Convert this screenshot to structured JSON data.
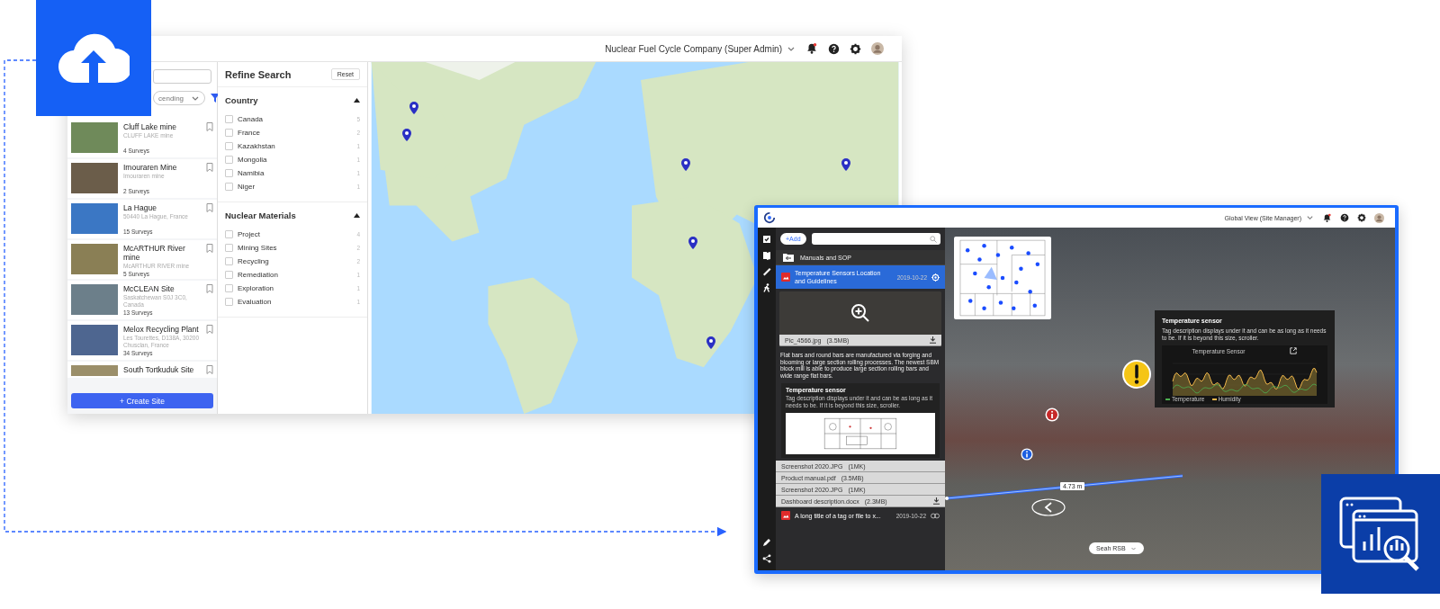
{
  "sites_app": {
    "header": {
      "account": "Nuclear Fuel Cycle Company (Super Admin)"
    },
    "site_list": {
      "sort": "cending",
      "sites": [
        {
          "name": "Cluff Lake mine",
          "address": "CLUFF LAKE mine",
          "surveys": "4 Surveys"
        },
        {
          "name": "Imouraren Mine",
          "address": "Imouraren mine",
          "surveys": "2 Surveys"
        },
        {
          "name": "La Hague",
          "address": "50440 La Hague, France",
          "surveys": "15 Surveys"
        },
        {
          "name": "McARTHUR River mine",
          "address": "McARTHUR RIVER mine",
          "surveys": "5 Surveys"
        },
        {
          "name": "McCLEAN Site",
          "address": "Saskatchewan S0J 3C0, Canada",
          "surveys": "13 Surveys"
        },
        {
          "name": "Melox Recycling Plant",
          "address": "Les Tourettes, D138A, 30200 Chusclan, France",
          "surveys": "34 Surveys"
        },
        {
          "name": "South Tortkuduk Site"
        }
      ],
      "create_button": "+ Create Site"
    },
    "refine": {
      "title": "Refine Search",
      "reset": "Reset",
      "sections": [
        {
          "title": "Country",
          "expanded": true,
          "options": [
            {
              "label": "Canada",
              "count": "5",
              "checked": false
            },
            {
              "label": "France",
              "count": "2",
              "checked": false
            },
            {
              "label": "Kazakhstan",
              "count": "1",
              "checked": false
            },
            {
              "label": "Mongolia",
              "count": "1",
              "checked": false
            },
            {
              "label": "Namibia",
              "count": "1",
              "checked": false
            },
            {
              "label": "Niger",
              "count": "1",
              "checked": false
            }
          ]
        },
        {
          "title": "Nuclear Materials",
          "expanded": true,
          "options": [
            {
              "label": "Project",
              "count": "4",
              "checked": false
            },
            {
              "label": "Mining Sites",
              "count": "2",
              "checked": false
            },
            {
              "label": "Recycling",
              "count": "2",
              "checked": false
            },
            {
              "label": "Remediation",
              "count": "1",
              "checked": false
            },
            {
              "label": "Exploration",
              "count": "1",
              "checked": false
            },
            {
              "label": "Evaluation",
              "count": "1",
              "checked": false
            }
          ]
        }
      ]
    }
  },
  "viewer_app": {
    "header": {
      "view": "Global View (Site Manager)"
    },
    "panel": {
      "add_button": "+Add",
      "folder": "Manuals and SOP",
      "items": [
        {
          "title": "Temperature Sensors Location and Guidelines",
          "date": "2019-10-22",
          "selected": true
        },
        {
          "title": "A long title of a tag or file to x...",
          "date": "2019-10-22",
          "selected": false
        }
      ],
      "preview_file": {
        "name": "Pic_4566.jpg",
        "size": "(3.5MB)"
      },
      "description": "Flat bars and round bars are manufactured via forging and blooming or large section rolling processes. The newest SBM block mill is able to produce large section rolling bars and wide range flat bars.",
      "sensor_card": {
        "title": "Temperature sensor",
        "text": "Tag description displays under it and can be as long as it needs to be. If it is beyond this size, scroller."
      },
      "files": [
        {
          "name": "Screenshot 2020.JPG",
          "size": "(1MK)"
        },
        {
          "name": "Product manual.pdf",
          "size": "(3.5MB)"
        },
        {
          "name": "Screenshot 2020.JPG",
          "size": "(1MK)"
        },
        {
          "name": "Dashboard description.docx",
          "size": "(2.3MB)"
        }
      ]
    },
    "viewer": {
      "tooltip": {
        "title": "Temperature sensor",
        "text": "Tag description displays under it and can be as long as it needs to be. If it is beyond this size, scroller.",
        "chart_title": "Temperature Sensor",
        "legend": [
          "Temperature",
          "Humidity"
        ]
      },
      "measurement": "4.73 m",
      "location": "Seah RSB"
    }
  }
}
